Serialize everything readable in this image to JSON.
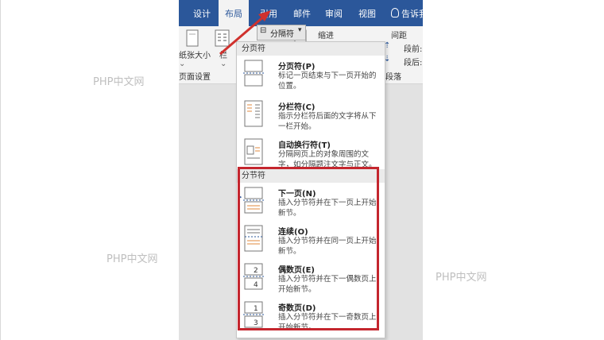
{
  "tabs": [
    {
      "label": "设计",
      "active": false
    },
    {
      "label": "布局",
      "active": true
    },
    {
      "label": "引用",
      "active": false
    },
    {
      "label": "邮件",
      "active": false
    },
    {
      "label": "审阅",
      "active": false
    },
    {
      "label": "视图",
      "active": false
    }
  ],
  "tell_me": "告诉我...",
  "ribbon": {
    "paper_size": "纸张大小",
    "orientation_fragment": "栏",
    "breaks_button": "分隔符",
    "indent": "缩进",
    "spacing": "间距",
    "before_label": "段前:",
    "after_label": "段后:",
    "group_setup": "页面设置",
    "group_paragraph": "段落"
  },
  "menu": {
    "page_breaks_header": "分页符",
    "section_breaks_header": "分节符",
    "page_items": [
      {
        "title": "分页符(P)",
        "desc": "标记一页结束与下一页开始的位置。",
        "icon": "page-break-icon"
      },
      {
        "title": "分栏符(C)",
        "desc": "指示分栏符后面的文字将从下一栏开始。",
        "icon": "column-break-icon"
      },
      {
        "title": "自动换行符(T)",
        "desc": "分隔网页上的对象周围的文字，如分隔题注文字与正文。",
        "icon": "text-wrapping-break-icon"
      }
    ],
    "section_items": [
      {
        "title": "下一页(N)",
        "desc": "插入分节符并在下一页上开始新节。",
        "icon": "next-page-section-icon"
      },
      {
        "title": "连续(O)",
        "desc": "插入分节符并在同一页上开始新节。",
        "icon": "continuous-section-icon"
      },
      {
        "title": "偶数页(E)",
        "desc": "插入分节符并在下一偶数页上开始新节。",
        "icon": "even-page-section-icon",
        "badge": "4"
      },
      {
        "title": "奇数页(D)",
        "desc": "插入分节符并在下一奇数页上开始新节。",
        "icon": "odd-page-section-icon",
        "badge": "3"
      }
    ]
  },
  "watermarks": [
    "PHP中文网",
    "PHP中文网",
    "PHP中文网"
  ],
  "colors": {
    "ribbon_blue": "#2b579a",
    "highlight_red": "#c4262e",
    "arrow_red": "#d0312d"
  }
}
